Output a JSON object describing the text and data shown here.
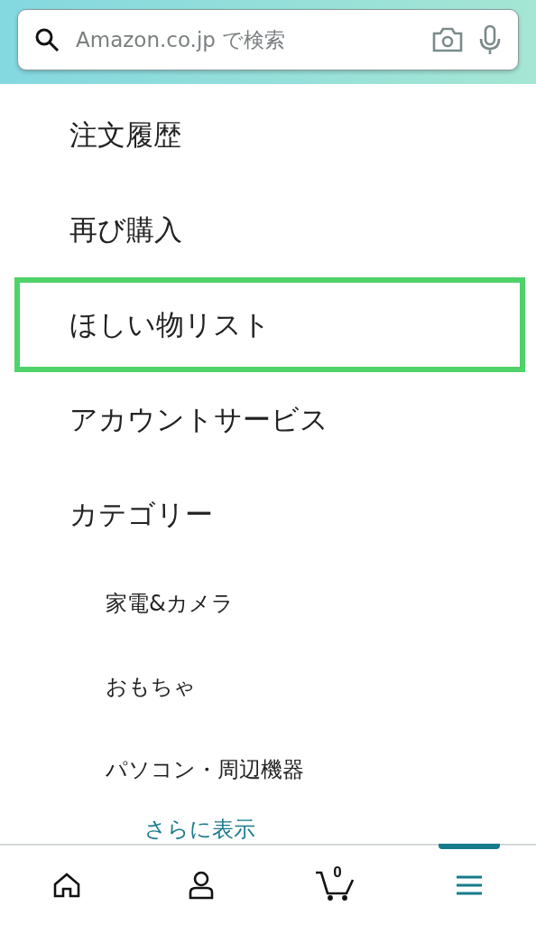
{
  "search": {
    "placeholder": "Amazon.co.jp で検索"
  },
  "menu": [
    {
      "label": "注文履歴",
      "selected": false
    },
    {
      "label": "再び購入",
      "selected": false
    },
    {
      "label": "ほしい物リスト",
      "selected": true
    },
    {
      "label": "アカウントサービス",
      "selected": false
    },
    {
      "label": "カテゴリー",
      "selected": false
    }
  ],
  "categories": [
    {
      "label": "家電&カメラ"
    },
    {
      "label": "おもちゃ"
    },
    {
      "label": "パソコン・周辺機器"
    }
  ],
  "show_more": "さらに表示",
  "nav": {
    "cart_count": "0",
    "tabs": [
      {
        "kind": "home",
        "selected": false
      },
      {
        "kind": "account",
        "selected": false
      },
      {
        "kind": "cart",
        "selected": false
      },
      {
        "kind": "menu",
        "selected": true
      }
    ]
  }
}
